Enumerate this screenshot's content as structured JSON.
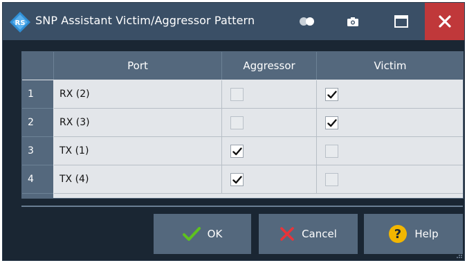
{
  "window": {
    "title": "SNP Assistant Victim/Aggressor Pattern",
    "icons": [
      "rs-logo-icon",
      "toggle-icon",
      "camera-icon",
      "maximize-icon",
      "close-icon"
    ],
    "colors": {
      "titlebar": "#3a4f66",
      "close": "#c0383a",
      "body": "#1a2633",
      "header": "#54687d"
    }
  },
  "table": {
    "headers": {
      "port": "Port",
      "aggressor": "Aggressor",
      "victim": "Victim"
    },
    "rows": [
      {
        "num": "1",
        "port": "RX (2)",
        "aggressor": false,
        "victim": true
      },
      {
        "num": "2",
        "port": "RX (3)",
        "aggressor": false,
        "victim": true
      },
      {
        "num": "3",
        "port": "TX (1)",
        "aggressor": true,
        "victim": false
      },
      {
        "num": "4",
        "port": "TX (4)",
        "aggressor": true,
        "victim": false
      }
    ]
  },
  "buttons": {
    "ok": {
      "label": "OK",
      "icon": "check-icon",
      "color": "#5ec21e"
    },
    "cancel": {
      "label": "Cancel",
      "icon": "x-icon",
      "color": "#e8343a"
    },
    "help": {
      "label": "Help",
      "icon": "question-icon",
      "color": "#f2b600"
    }
  }
}
